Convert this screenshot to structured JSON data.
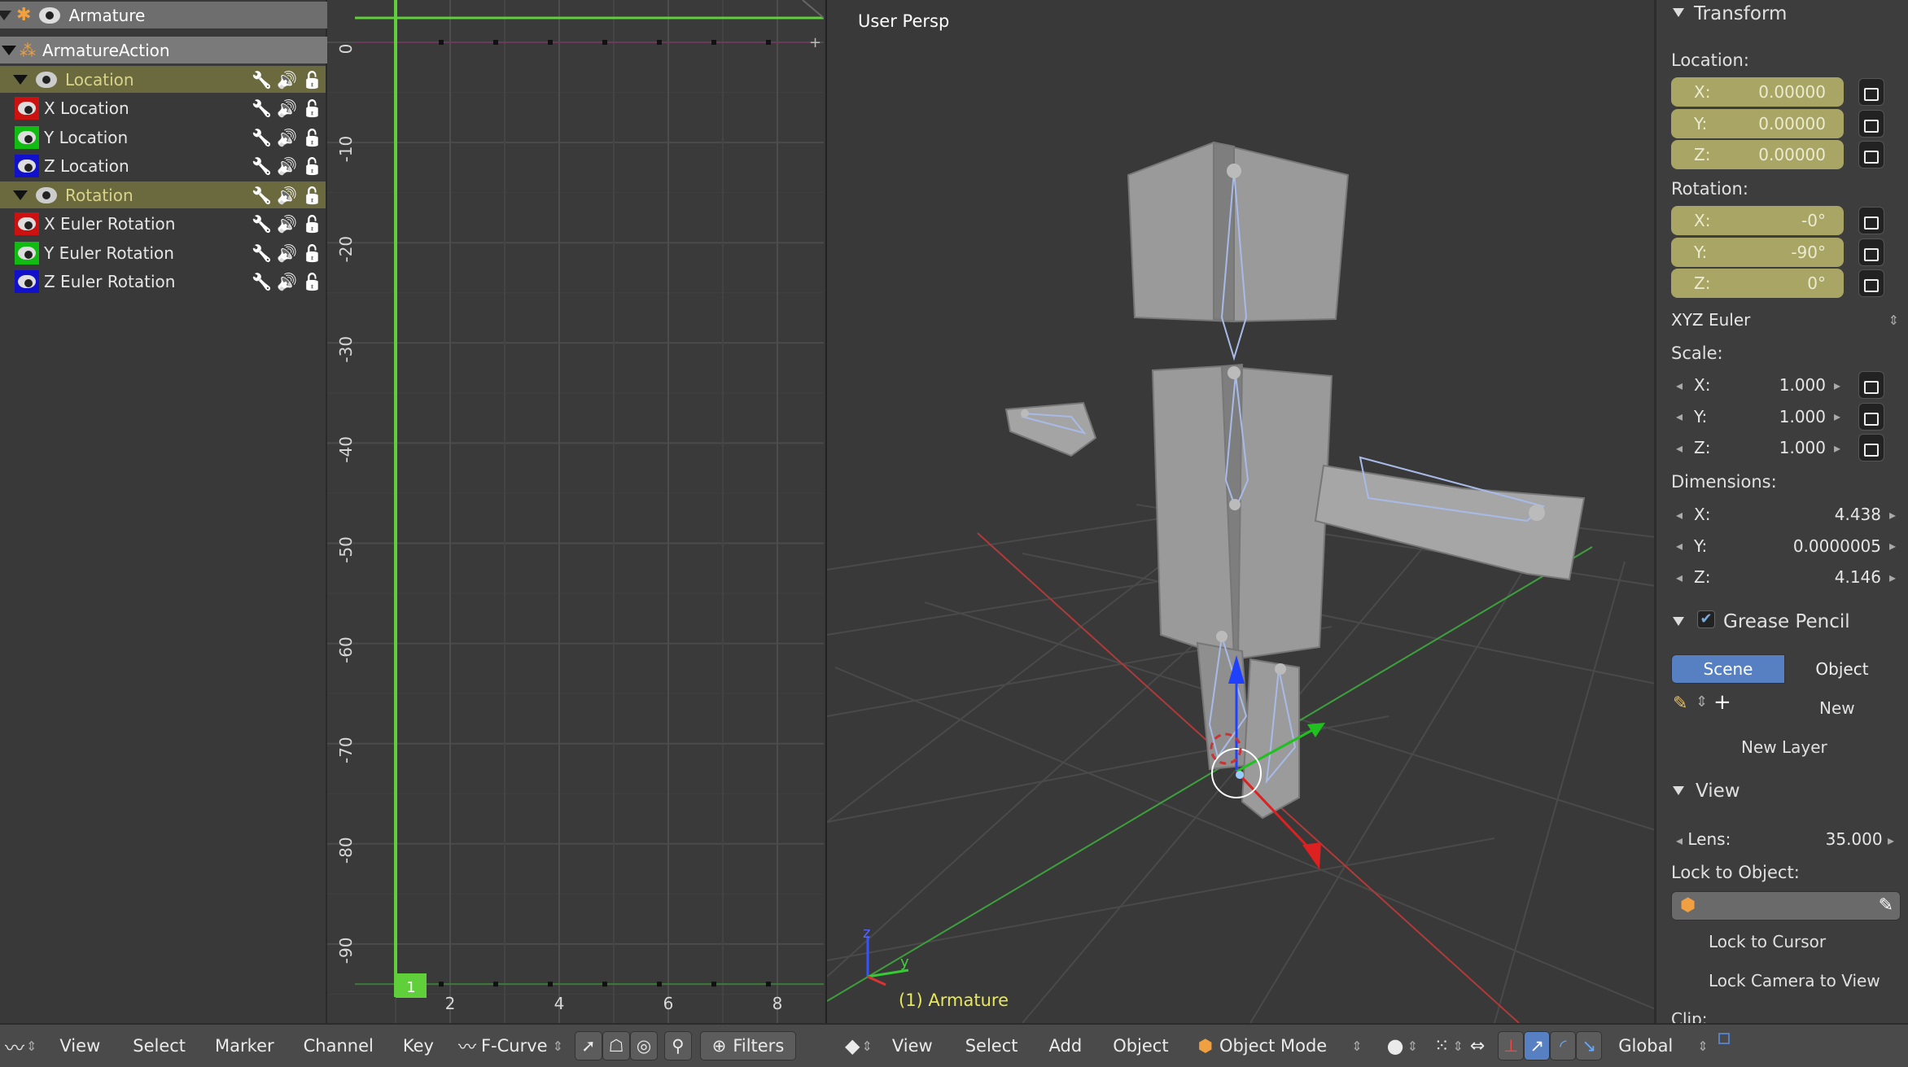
{
  "channels": {
    "object": "Armature",
    "action": "ArmatureAction",
    "rows": [
      {
        "label": "Location",
        "kind": "group"
      },
      {
        "label": "X Location",
        "kind": "curve",
        "color": "#cc1111"
      },
      {
        "label": "Y Location",
        "kind": "curve",
        "color": "#11bb11"
      },
      {
        "label": "Z Location",
        "kind": "curve",
        "color": "#1111cc"
      },
      {
        "label": "Rotation",
        "kind": "group"
      },
      {
        "label": "X Euler Rotation",
        "kind": "curve",
        "color": "#cc1111"
      },
      {
        "label": "Y Euler Rotation",
        "kind": "curve",
        "color": "#11bb11"
      },
      {
        "label": "Z Euler Rotation",
        "kind": "curve",
        "color": "#1111cc"
      }
    ]
  },
  "graph": {
    "y_ticks": [
      "0",
      "-10",
      "-20",
      "-30",
      "-40",
      "-50",
      "-60",
      "-70",
      "-80",
      "-90"
    ],
    "x_ticks": [
      "2",
      "4",
      "6",
      "8"
    ],
    "current_frame": "1"
  },
  "viewport": {
    "title": "User Persp",
    "object_label": "(1) Armature",
    "axis_z": "z",
    "axis_y": "y"
  },
  "props": {
    "transform": "Transform",
    "location": "Location:",
    "loc": [
      {
        "axis": "X:",
        "value": "0.00000"
      },
      {
        "axis": "Y:",
        "value": "0.00000"
      },
      {
        "axis": "Z:",
        "value": "0.00000"
      }
    ],
    "rotation": "Rotation:",
    "rot": [
      {
        "axis": "X:",
        "value": "-0°"
      },
      {
        "axis": "Y:",
        "value": "-90°"
      },
      {
        "axis": "Z:",
        "value": "0°"
      }
    ],
    "rotation_mode": "XYZ Euler",
    "scale": "Scale:",
    "scl": [
      {
        "axis": "X:",
        "value": "1.000"
      },
      {
        "axis": "Y:",
        "value": "1.000"
      },
      {
        "axis": "Z:",
        "value": "1.000"
      }
    ],
    "dimensions": "Dimensions:",
    "dim": [
      {
        "axis": "X:",
        "value": "4.438"
      },
      {
        "axis": "Y:",
        "value": "0.0000005"
      },
      {
        "axis": "Z:",
        "value": "4.146"
      }
    ],
    "grease_pencil": "Grease Pencil",
    "gp_scene": "Scene",
    "gp_object": "Object",
    "gp_new": "New",
    "gp_new_layer": "New Layer",
    "view": "View",
    "lens_label": "Lens:",
    "lens_value": "35.000",
    "lock_object": "Lock to Object:",
    "lock_cursor": "Lock to Cursor",
    "lock_camera": "Lock Camera to View",
    "clip": "Clip:"
  },
  "graph_header": {
    "view": "View",
    "select": "Select",
    "marker": "Marker",
    "channel": "Channel",
    "key": "Key",
    "mode": "F-Curve",
    "filters": "Filters"
  },
  "view_header": {
    "view": "View",
    "select": "Select",
    "add": "Add",
    "object": "Object",
    "mode": "Object Mode",
    "orientation": "Global"
  },
  "colors": {
    "accent": "#5680c2",
    "graph_green": "#5fcf3a",
    "anim_field": "#a8a565",
    "group": "#6b6a3f"
  }
}
